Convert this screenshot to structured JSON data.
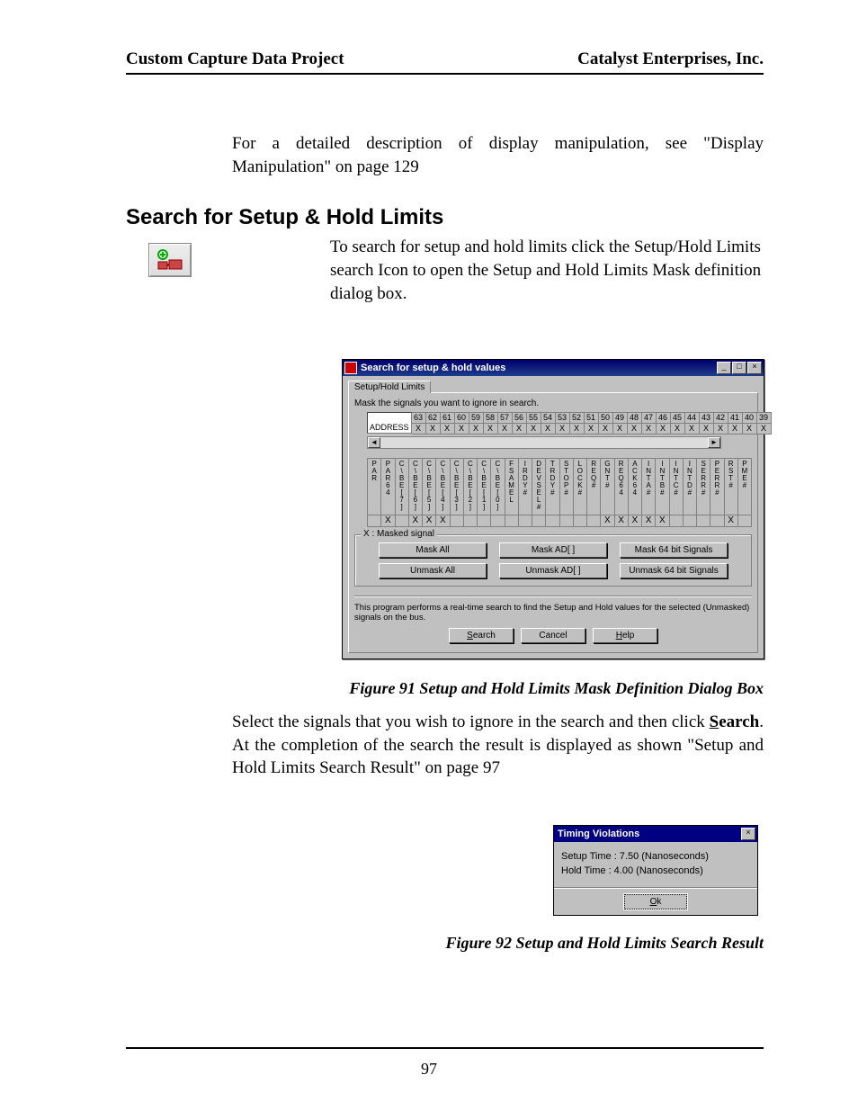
{
  "header": {
    "left": "Custom Capture Data Project",
    "right": "Catalyst Enterprises, Inc."
  },
  "intro_para": "For a detailed description of display manipulation, see  \"Display Manipulation\" on page 129",
  "section_heading": "Search for Setup & Hold Limits",
  "section_para": "To search for setup and hold limits click the Setup/Hold Limits search Icon to open the Setup and Hold Limits Mask definition dialog box.",
  "dialog1": {
    "title": "Search for setup & hold values",
    "tab": "Setup/Hold Limits",
    "instruction": "Mask the signals you want to ignore in search.",
    "address_label": "ADDRESS",
    "address_numbers": [
      "63",
      "62",
      "61",
      "60",
      "59",
      "58",
      "57",
      "56",
      "55",
      "54",
      "53",
      "52",
      "51",
      "50",
      "49",
      "48",
      "47",
      "46",
      "45",
      "44",
      "43",
      "42",
      "41",
      "40",
      "39"
    ],
    "address_marks": [
      "X",
      "X",
      "X",
      "X",
      "X",
      "X",
      "X",
      "X",
      "X",
      "X",
      "X",
      "X",
      "X",
      "X",
      "X",
      "X",
      "X",
      "X",
      "X",
      "X",
      "X",
      "X",
      "X",
      "X",
      "X"
    ],
    "signals": [
      {
        "name": "PAR",
        "x": ""
      },
      {
        "name": "PAR64",
        "x": "X"
      },
      {
        "name": "C\\BE[7]",
        "x": ""
      },
      {
        "name": "C\\BE[6]",
        "x": "X"
      },
      {
        "name": "C\\BE[5]",
        "x": "X"
      },
      {
        "name": "C\\BE[4]",
        "x": "X"
      },
      {
        "name": "C\\BE[3]",
        "x": ""
      },
      {
        "name": "C\\BE[2]",
        "x": ""
      },
      {
        "name": "C\\BE[1]",
        "x": ""
      },
      {
        "name": "C\\BE[0]",
        "x": ""
      },
      {
        "name": "FSAMEL",
        "x": ""
      },
      {
        "name": "IRDY#",
        "x": ""
      },
      {
        "name": "DEVSEL#",
        "x": ""
      },
      {
        "name": "TRDY#",
        "x": ""
      },
      {
        "name": "STOP#",
        "x": ""
      },
      {
        "name": "LOCK#",
        "x": ""
      },
      {
        "name": "REQ#",
        "x": ""
      },
      {
        "name": "GNT#",
        "x": "X"
      },
      {
        "name": "REQ64",
        "x": "X"
      },
      {
        "name": "ACK64",
        "x": "X"
      },
      {
        "name": "INTA#",
        "x": "X"
      },
      {
        "name": "INTB#",
        "x": "X"
      },
      {
        "name": "INTC#",
        "x": ""
      },
      {
        "name": "INTD#",
        "x": ""
      },
      {
        "name": "SERR#",
        "x": ""
      },
      {
        "name": "PERR#",
        "x": ""
      },
      {
        "name": "RST#",
        "x": "X"
      },
      {
        "name": "PME#",
        "x": ""
      }
    ],
    "group_legend": "X : Masked signal",
    "buttons_col1": {
      "a": "Mask All",
      "b": "Unmask All"
    },
    "buttons_col2": {
      "a": "Mask AD[ ]",
      "b": "Unmask AD[ ]"
    },
    "buttons_col3": {
      "a": "Mask 64 bit Signals",
      "b": "Unmask 64 bit Signals"
    },
    "note": "This program performs a real-time search to find the Setup and Hold values for the selected (Unmasked) signals on the bus.",
    "bottom": {
      "search": "Search",
      "cancel": "Cancel",
      "help": "Help"
    }
  },
  "fig91_caption": "Figure  91  Setup and Hold Limits Mask Definition Dialog Box",
  "after_para_pre": "Select the signals that you wish to ignore in the search and then click ",
  "after_para_bold": "Search",
  "after_para_post": ". At the completion of the search the result is displayed as shown \"Setup and Hold Limits Search Result\" on page 97",
  "dialog2": {
    "title": "Timing Violations",
    "line1": "Setup Time :  7.50  (Nanoseconds)",
    "line2": "Hold   Time :  4.00  (Nanoseconds)",
    "ok": "Ok"
  },
  "fig92_caption": "Figure  92  Setup and Hold Limits Search Result",
  "page_number": "97"
}
